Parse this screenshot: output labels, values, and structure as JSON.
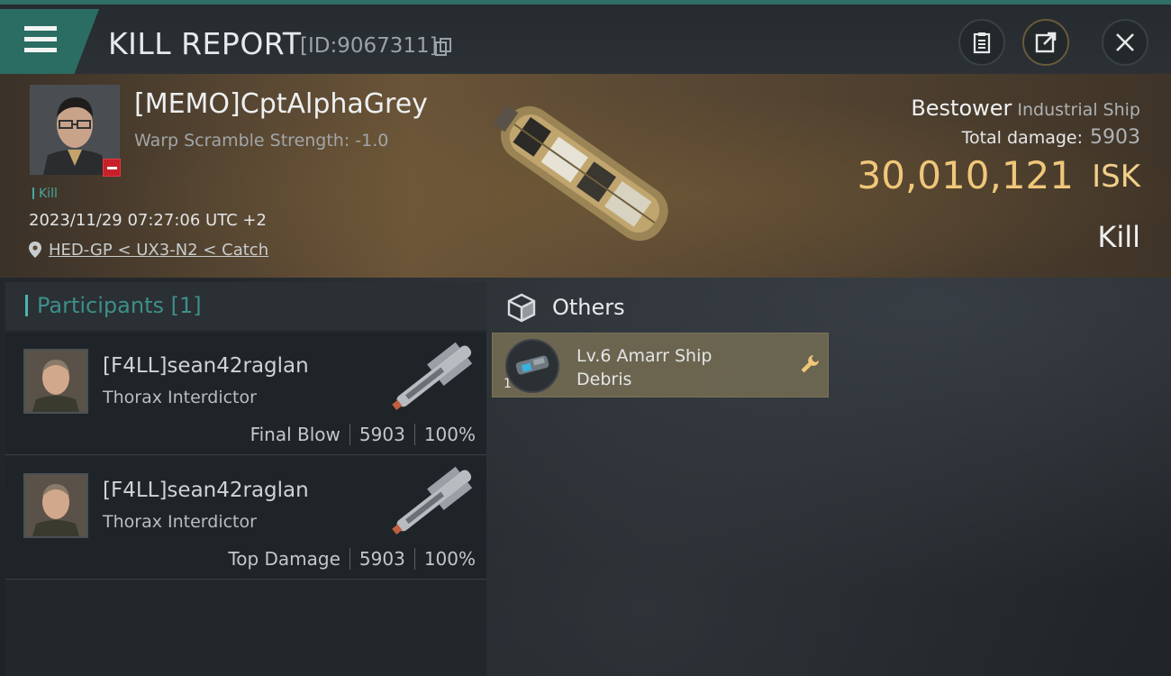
{
  "header": {
    "title": "KILL REPORT",
    "report_id": "[ID:9067311]",
    "buttons": {
      "clipboard": "clipboard-icon",
      "share": "share-icon",
      "close": "close-icon"
    }
  },
  "victim": {
    "name": "[MEMO]CptAlphaGrey",
    "warp_scramble": "Warp Scramble Strength: -1.0",
    "tag": "Kill",
    "timestamp": "2023/11/29 07:27:06 UTC +2",
    "location": "HED-GP < UX3-N2 < Catch",
    "ship_name": "Bestower",
    "ship_class": "Industrial Ship",
    "total_damage_label": "Total damage:",
    "total_damage_value": "5903",
    "isk_value": "30,010,121",
    "isk_label": "ISK",
    "result": "Kill"
  },
  "participants": {
    "title": "Participants [1]",
    "items": [
      {
        "name": "[F4LL]sean42raglan",
        "ship": "Thorax Interdictor",
        "stat_label": "Final Blow",
        "damage": "5903",
        "percent": "100%"
      },
      {
        "name": "[F4LL]sean42raglan",
        "ship": "Thorax Interdictor",
        "stat_label": "Top Damage",
        "damage": "5903",
        "percent": "100%"
      }
    ]
  },
  "others": {
    "title": "Others",
    "items": [
      {
        "name": "Lv.6 Amarr Ship Debris",
        "quantity": "1"
      }
    ]
  },
  "colors": {
    "accent_teal": "#2b6d63",
    "isk_gold": "#f0c77a",
    "item_card": "#6c6550"
  }
}
